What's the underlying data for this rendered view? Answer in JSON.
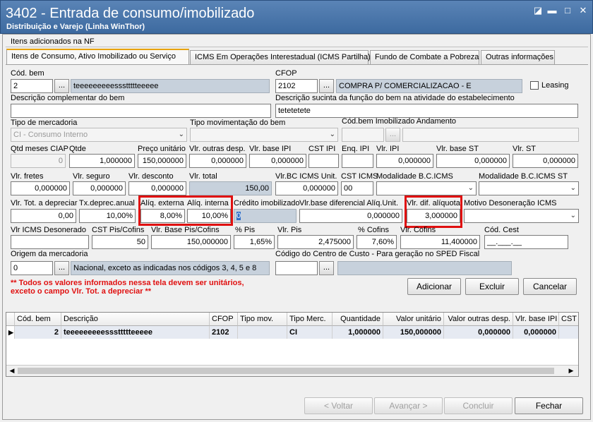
{
  "window": {
    "title": "3402 - Entrada de consumo/imobilizado",
    "subtitle": "Distribuição e Varejo (Linha WinThor)"
  },
  "group": {
    "label": "Itens adicionados na NF"
  },
  "tabs": [
    "Itens de Consumo,  Ativo Imobilizado ou Serviço",
    "ICMS Em Operações Interestadual (ICMS Partilha)",
    "Fundo de Combate a Pobreza",
    "Outras informações"
  ],
  "form": {
    "cod_bem": {
      "label": "Cód. bem",
      "value": "2",
      "desc": "teeeeeeeeesssttttteeeee"
    },
    "cfop": {
      "label": "CFOP",
      "value": "2102",
      "desc": "COMPRA P/ COMERCIALIZACAO - E"
    },
    "leasing": {
      "label": "Leasing"
    },
    "desc_complementar": {
      "label": "Descrição complementar do bem",
      "value": ""
    },
    "desc_sucinta": {
      "label": "Descrição sucinta da função do bem na atividade do estabelecimento",
      "value": "tetetetete"
    },
    "tipo_mercadoria": {
      "label": "Tipo de mercadoria",
      "value": "CI - Consumo Interno"
    },
    "tipo_movimentacao": {
      "label": "Tipo movimentação do bem",
      "value": ""
    },
    "cod_bem_imob": {
      "label": "Cód.bem Imobilizado Andamento",
      "value": ""
    },
    "row4": [
      {
        "label": "Qtd meses CIAP",
        "value": "0"
      },
      {
        "label": "Qtde",
        "value": "1,000000"
      },
      {
        "label": "Preço unitário",
        "value": "150,000000"
      },
      {
        "label": "Vlr. outras desp.",
        "value": "0,000000"
      },
      {
        "label": "Vlr. base IPI",
        "value": "0,000000"
      },
      {
        "label": "CST IPI",
        "value": ""
      },
      {
        "label": "Enq. IPI",
        "value": ""
      },
      {
        "label": "Vlr. IPI",
        "value": "0,000000"
      },
      {
        "label": "Vlr. base ST",
        "value": "0,000000"
      },
      {
        "label": "Vlr. ST",
        "value": "0,000000"
      }
    ],
    "row5": [
      {
        "label": "Vlr. fretes",
        "value": "0,000000"
      },
      {
        "label": "Vlr. seguro",
        "value": "0,000000"
      },
      {
        "label": "Vlr. desconto",
        "value": "0,000000"
      },
      {
        "label": "Vlr. total",
        "value": "150,00"
      },
      {
        "label": "Vlr.BC ICMS Unit.",
        "value": "0,000000"
      },
      {
        "label": "CST ICMS",
        "value": "00"
      },
      {
        "label": "Modalidade B.C.ICMS",
        "value": ""
      },
      {
        "label": "Modalidade B.C.ICMS ST",
        "value": ""
      }
    ],
    "row6": [
      {
        "label": "Vlr. Tot. a depreciar",
        "value": "0,00"
      },
      {
        "label": "Tx.deprec.anual",
        "value": "10,00%"
      },
      {
        "label": "Alíq. externa",
        "value": "8,00%"
      },
      {
        "label": "Alíq. interna",
        "value": "10,00%"
      },
      {
        "label": "Crédito imobilizado",
        "value": "0"
      },
      {
        "label": "Vlr.base diferencial Alíq.Unit.",
        "value": "0,000000"
      },
      {
        "label": "Vlr. dif. alíquota",
        "value": "3,000000"
      },
      {
        "label": "Motivo Desoneração ICMS",
        "value": ""
      }
    ],
    "row7": [
      {
        "label": "Vlr ICMS Desonerado",
        "value": ""
      },
      {
        "label": "CST Pis/Cofins",
        "value": "50"
      },
      {
        "label": "Vlr. Base Pis/Cofins",
        "value": "150,000000"
      },
      {
        "label": "% Pis",
        "value": "1,65%"
      },
      {
        "label": "Vlr. Pis",
        "value": "2,475000"
      },
      {
        "label": "% Cofins",
        "value": "7,60%"
      },
      {
        "label": "Vlr. Cofins",
        "value": "11,400000"
      },
      {
        "label": "Cód. Cest",
        "value": "__.___.__"
      }
    ],
    "origem": {
      "label": "Origem da mercadoria",
      "value": "0",
      "desc": "Nacional, exceto as indicadas nos códigos 3, 4, 5 e 8"
    },
    "centro_custo": {
      "label": "Código do Centro de Custo - Para geração no SPED Fiscal",
      "value": "",
      "desc": ""
    },
    "warning": [
      "** Todos os valores informados nessa tela devem ser unitários,",
      "exceto o campo Vlr. Tot. a depreciar **"
    ]
  },
  "actions": {
    "adicionar": "Adicionar",
    "excluir": "Excluir",
    "cancelar": "Cancelar"
  },
  "grid": {
    "columns": [
      "Cód. bem",
      "Descrição",
      "CFOP",
      "Tipo mov.",
      "Tipo Merc.",
      "Quantidade",
      "Valor unitário",
      "Valor outras desp.",
      "Vlr. base IPI",
      "CST I"
    ],
    "rows": [
      [
        "2",
        "teeeeeeeeesssttttteeeee",
        "2102",
        "",
        "CI",
        "1,000000",
        "150,000000",
        "0,000000",
        "0,000000",
        ""
      ]
    ]
  },
  "footer": {
    "voltar": "< Voltar",
    "avancar": "Avançar >",
    "concluir": "Concluir",
    "fechar": "Fechar"
  }
}
